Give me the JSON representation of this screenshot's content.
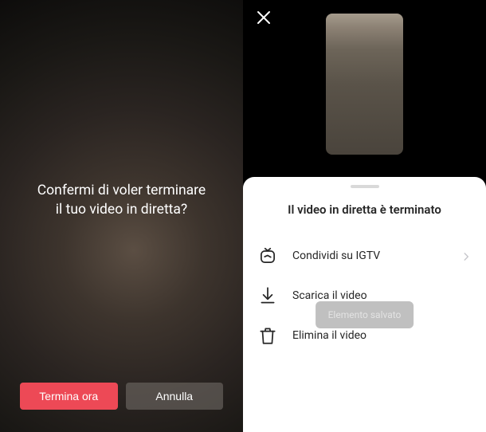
{
  "left": {
    "confirm_line1": "Confermi di voler terminare",
    "confirm_line2": "il tuo video in diretta?",
    "end_button": "Termina ora",
    "cancel_button": "Annulla"
  },
  "right": {
    "sheet_title": "Il video in diretta è terminato",
    "items": [
      {
        "label": "Condividi su IGTV",
        "icon": "igtv-icon",
        "chevron": true
      },
      {
        "label": "Scarica il video",
        "icon": "download-icon",
        "chevron": false
      },
      {
        "label": "Elimina il video",
        "icon": "trash-icon",
        "chevron": false
      }
    ],
    "toast": "Elemento salvato"
  },
  "colors": {
    "primary": "#ed4956",
    "text_dark": "#262626"
  }
}
